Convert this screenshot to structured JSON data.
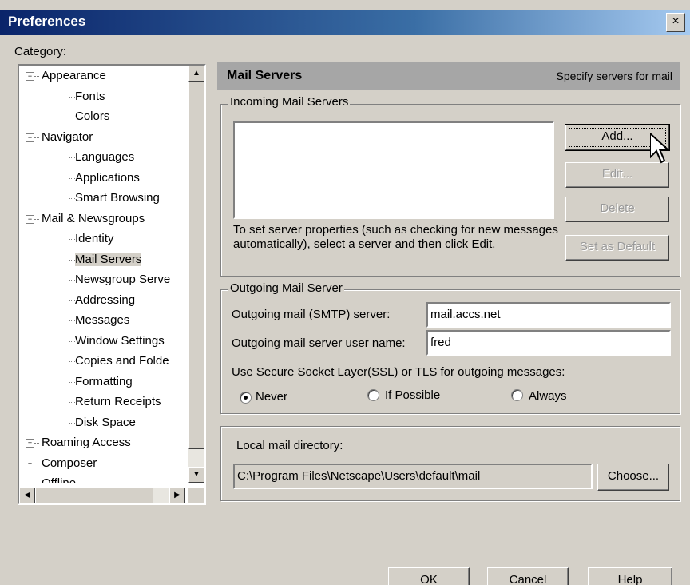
{
  "window": {
    "title": "Preferences",
    "close_glyph": "×"
  },
  "category_label": "Category:",
  "tree": [
    {
      "label": "Appearance",
      "level": 0,
      "expander": "−"
    },
    {
      "label": "Fonts",
      "level": 1
    },
    {
      "label": "Colors",
      "level": 1
    },
    {
      "label": "Navigator",
      "level": 0,
      "expander": "−"
    },
    {
      "label": "Languages",
      "level": 1
    },
    {
      "label": "Applications",
      "level": 1
    },
    {
      "label": "Smart Browsing",
      "level": 1
    },
    {
      "label": "Mail & Newsgroups",
      "level": 0,
      "expander": "−"
    },
    {
      "label": "Identity",
      "level": 1
    },
    {
      "label": "Mail Servers",
      "level": 1,
      "selected": true
    },
    {
      "label": "Newsgroup Serve",
      "level": 1
    },
    {
      "label": "Addressing",
      "level": 1
    },
    {
      "label": "Messages",
      "level": 1
    },
    {
      "label": "Window Settings",
      "level": 1
    },
    {
      "label": "Copies and Folde",
      "level": 1
    },
    {
      "label": "Formatting",
      "level": 1
    },
    {
      "label": "Return Receipts",
      "level": 1
    },
    {
      "label": "Disk Space",
      "level": 1
    },
    {
      "label": "Roaming Access",
      "level": 0,
      "expander": "+"
    },
    {
      "label": "Composer",
      "level": 0,
      "expander": "+"
    },
    {
      "label": "Offline",
      "level": 0,
      "expander": "+"
    }
  ],
  "header": {
    "title": "Mail Servers",
    "subtitle": "Specify servers for mail"
  },
  "incoming": {
    "group_title": "Incoming Mail Servers",
    "hint": "To set server properties (such as checking for new messages automatically), select a server and then click Edit.",
    "add_label": "Add...",
    "edit_label": "Edit...",
    "delete_label": "Delete",
    "default_label": "Set as Default"
  },
  "outgoing": {
    "group_title": "Outgoing Mail Server",
    "smtp_label": "Outgoing mail (SMTP) server:",
    "smtp_value": "mail.accs.net",
    "user_label": "Outgoing mail server user name:",
    "user_value": "fred",
    "ssl_label": "Use Secure Socket Layer(SSL) or TLS for outgoing messages:",
    "options": [
      "Never",
      "If Possible",
      "Always"
    ],
    "selected": "Never"
  },
  "local": {
    "label": "Local mail directory:",
    "path": "C:\\Program Files\\Netscape\\Users\\default\\mail",
    "choose_label": "Choose..."
  },
  "footer": {
    "ok": "OK",
    "cancel": "Cancel",
    "help": "Help"
  }
}
